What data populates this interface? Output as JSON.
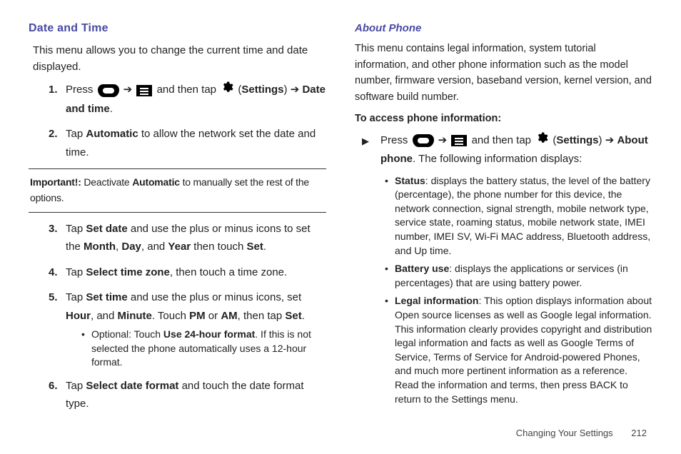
{
  "left": {
    "heading": "Date and Time",
    "intro": "This menu allows you to change the current time and date displayed.",
    "step1_a": "Press ",
    "step1_b": " ➔ ",
    "step1_c": " and then tap ",
    "step1_d": " (",
    "step1_settings": "Settings",
    "step1_e": ") ➔ ",
    "step1_dt": "Date and time",
    "step1_f": ".",
    "step2_a": "Tap ",
    "step2_auto": "Automatic",
    "step2_b": " to allow the network set the date and time.",
    "note_lead": "Important!: ",
    "note_a": "Deactivate ",
    "note_auto": "Automatic",
    "note_b": " to manually set the rest of the options.",
    "step3_a": "Tap ",
    "step3_setdate": "Set date",
    "step3_b": " and use the plus or minus icons to set the ",
    "step3_month": "Month",
    "step3_c": ", ",
    "step3_day": "Day",
    "step3_d": ", and ",
    "step3_year": "Year",
    "step3_e": " then touch ",
    "step3_set": "Set",
    "step3_f": ".",
    "step4_a": "Tap ",
    "step4_stz": "Select time zone",
    "step4_b": ", then touch a time zone.",
    "step5_a": "Tap ",
    "step5_settime": "Set time",
    "step5_b": " and use the plus or minus icons, set ",
    "step5_hour": "Hour",
    "step5_c": ", and ",
    "step5_min": "Minute",
    "step5_d": ". Touch ",
    "step5_pm": "PM",
    "step5_e": " or ",
    "step5_am": "AM",
    "step5_f": ", then tap ",
    "step5_set": "Set",
    "step5_g": ".",
    "step5_opt_a": "Optional: Touch ",
    "step5_opt_use24": "Use 24-hour format",
    "step5_opt_b": ". If this is not selected the phone automatically uses a 12-hour format.",
    "step6_a": "Tap ",
    "step6_sdf": "Select date format",
    "step6_b": " and touch the date format type."
  },
  "right": {
    "heading": "About Phone",
    "intro": "This menu contains legal information, system tutorial information, and other phone information such as the model number, firmware version, baseband version, kernel version, and software build number.",
    "access": "To access phone information:",
    "r1_a": "Press ",
    "r1_b": " ➔ ",
    "r1_c": " and then tap ",
    "r1_d": " (",
    "r1_settings": "Settings",
    "r1_e": ") ➔ ",
    "r1_about": "About phone",
    "r1_f": ". The following information displays:",
    "b1_head": "Status",
    "b1": ": displays the battery status, the level of the battery (percentage), the phone number for this device, the network connection, signal strength, mobile network type, service state, roaming status, mobile network state, IMEI number, IMEI SV, Wi-Fi MAC address, Bluetooth address, and Up time.",
    "b2_head": "Battery use",
    "b2": ": displays the applications or services (in percentages) that are using battery power.",
    "b3_head": "Legal information",
    "b3": ": This option displays information about Open source licenses as well as Google legal information. This information clearly provides copyright and distribution legal information and facts as well as Google Terms of Service, Terms of Service for Android-powered Phones, and much more pertinent information as a reference.",
    "b3_tail": "Read the information and terms, then press BACK to return to the Settings menu."
  },
  "footer": {
    "title": "Changing Your Settings",
    "page": "212"
  }
}
